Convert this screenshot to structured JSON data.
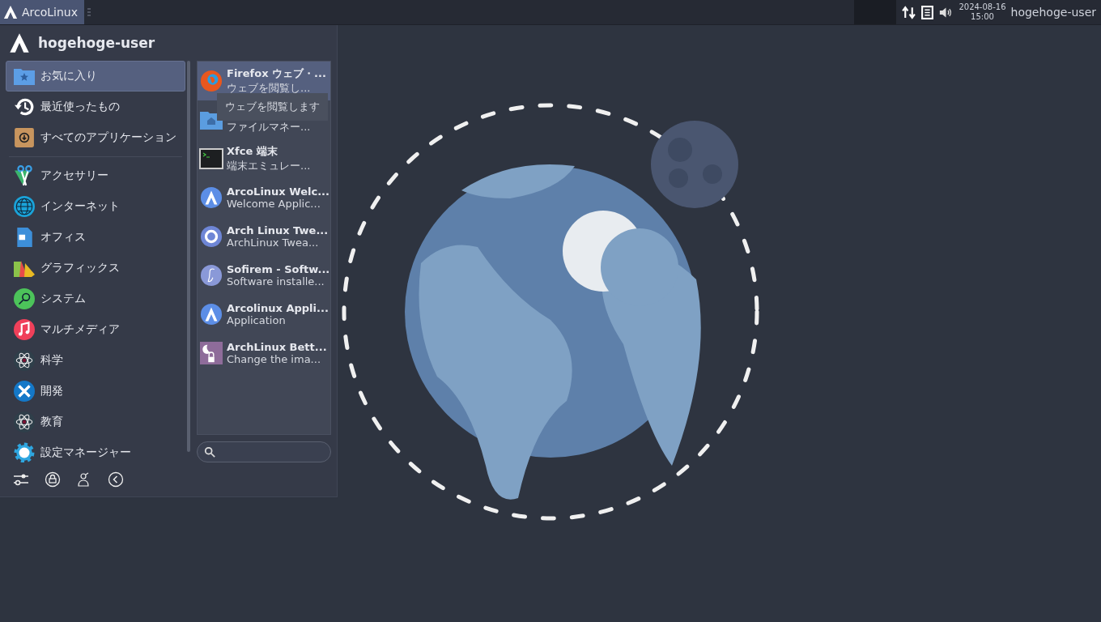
{
  "top_panel": {
    "menu_button": {
      "label": "ArcoLinux",
      "selected": true
    },
    "clock": {
      "date": "2024-08-16",
      "time": "15:00"
    },
    "user": "hogehoge-user"
  },
  "menu": {
    "user": "hogehoge-user",
    "places": [
      {
        "label": "お気に入り",
        "kind": "favorites",
        "selected": true
      },
      {
        "label": "最近使ったもの",
        "kind": "recent",
        "selected": false
      },
      {
        "label": "すべてのアプリケーション",
        "kind": "all",
        "selected": false
      }
    ],
    "categories": [
      {
        "label": "アクセサリー",
        "kind": "accessories",
        "selected": false
      },
      {
        "label": "インターネット",
        "kind": "internet",
        "selected": false
      },
      {
        "label": "オフィス",
        "kind": "office",
        "selected": false
      },
      {
        "label": "グラフィックス",
        "kind": "graphics",
        "selected": false
      },
      {
        "label": "システム",
        "kind": "system",
        "selected": false
      },
      {
        "label": "マルチメディア",
        "kind": "multimedia",
        "selected": false
      },
      {
        "label": "科学",
        "kind": "science",
        "selected": false
      },
      {
        "label": "開発",
        "kind": "development",
        "selected": false
      },
      {
        "label": "教育",
        "kind": "science",
        "selected": false
      },
      {
        "label": "設定マネージャー",
        "kind": "settings",
        "selected": false
      }
    ],
    "apps": [
      {
        "title": "Firefox ウェブ・...",
        "description": "ウェブを閲覧し...",
        "kind": "firefox",
        "selected": true
      },
      {
        "description": "ファイルマネー...",
        "kind": "folder",
        "selected": false
      },
      {
        "title": "Xfce 端末",
        "description": "端末エミュレー...",
        "kind": "terminal",
        "selected": false
      },
      {
        "title": "ArcoLinux Welc...",
        "description": "Welcome Applic...",
        "kind": "arco",
        "selected": false
      },
      {
        "title": "Arch Linux Twe...",
        "description": "ArchLinux Twea...",
        "kind": "ring",
        "selected": false
      },
      {
        "title": "Sofirem - Softw...",
        "description": "Software installe...",
        "kind": "sofirem",
        "selected": false
      },
      {
        "title": "Arcolinux Appli...",
        "description": "Application",
        "kind": "arco",
        "selected": false
      },
      {
        "title": "ArchLinux Bett...",
        "description": "Change the ima...",
        "kind": "lock",
        "selected": false
      }
    ],
    "tooltip": "ウェブを閲覧します"
  }
}
